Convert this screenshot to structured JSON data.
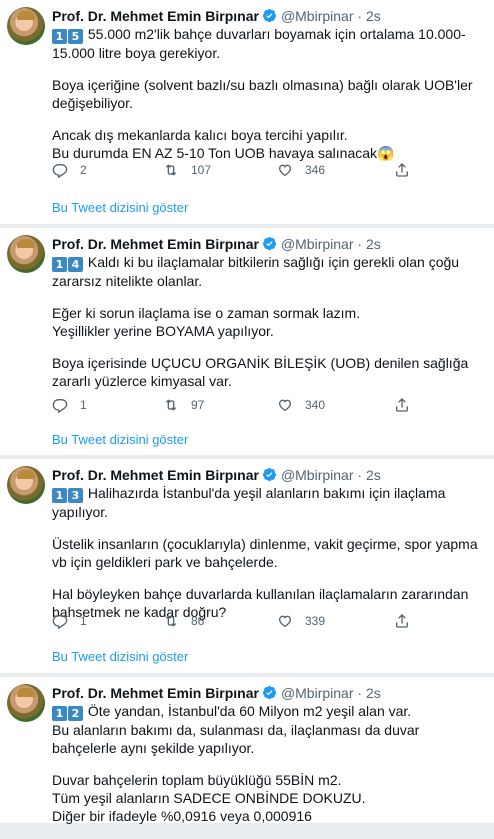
{
  "tweets": [
    {
      "name": "Prof. Dr. Mehmet Emin Birpınar",
      "handle": "@Mbirpinar",
      "dot": "·",
      "time": "2s",
      "digit1": "1",
      "digit2": "5",
      "paragraphs": [
        "55.000 m2'lik bahçe duvarları boyamak için ortalama 10.000-15.000 litre boya gerekiyor.",
        "Boya içeriğine (solvent bazlı/su bazlı olmasına) bağlı olarak UOB'ler değişebiliyor.",
        "Ancak dış mekanlarda kalıcı boya tercihi yapılır.\nBu durumda EN AZ 5-10 Ton UOB havaya salınacak😱"
      ],
      "replies": "2",
      "retweets": "107",
      "likes": "346",
      "thread_link": "Bu Tweet dizisini göster"
    },
    {
      "name": "Prof. Dr. Mehmet Emin Birpınar",
      "handle": "@Mbirpinar",
      "dot": "·",
      "time": "2s",
      "digit1": "1",
      "digit2": "4",
      "paragraphs": [
        "Kaldı ki bu ilaçlamalar bitkilerin sağlığı için gerekli olan çoğu zararsız nitelikte olanlar.",
        "Eğer ki sorun ilaçlama ise o zaman sormak lazım.\nYeşillikler yerine BOYAMA yapılıyor.",
        "Boya içerisinde UÇUCU ORGANİK BİLEŞİK (UOB) denilen sağlığa zararlı yüzlerce kimyasal var."
      ],
      "replies": "1",
      "retweets": "97",
      "likes": "340",
      "thread_link": "Bu Tweet dizisini göster"
    },
    {
      "name": "Prof. Dr. Mehmet Emin Birpınar",
      "handle": "@Mbirpinar",
      "dot": "·",
      "time": "2s",
      "digit1": "1",
      "digit2": "3",
      "paragraphs": [
        "Halihazırda İstanbul'da yeşil alanların bakımı için ilaçlama yapılıyor.",
        "Üstelik insanların (çocuklarıyla) dinlenme, vakit geçirme, spor yapma vb için geldikleri park ve bahçelerde.",
        "Hal böyleyken bahçe duvarlarda kullanılan ilaçlamaların zararından bahsetmek ne kadar doğru?"
      ],
      "replies": "1",
      "retweets": "86",
      "likes": "339",
      "thread_link": "Bu Tweet dizisini göster"
    },
    {
      "name": "Prof. Dr. Mehmet Emin Birpınar",
      "handle": "@Mbirpinar",
      "dot": "·",
      "time": "2s",
      "digit1": "1",
      "digit2": "2",
      "paragraphs": [
        "Öte yandan, İstanbul'da 60 Milyon m2 yeşil alan var.\nBu alanların bakımı da, sulanması da, ilaçlanması da duvar bahçelerle aynı şekilde yapılıyor.",
        "Duvar bahçelerin toplam büyüklüğü 55BİN m2.\nTüm yeşil alanların SADECE ONBİNDE DOKUZU.\nDiğer bir ifadeyle %0,0916 veya 0,000916"
      ]
    }
  ],
  "colors": {
    "link": "#1d9bf0",
    "verified": "#1d9bf0",
    "badge": "#3b88c3",
    "meta": "#536471"
  }
}
